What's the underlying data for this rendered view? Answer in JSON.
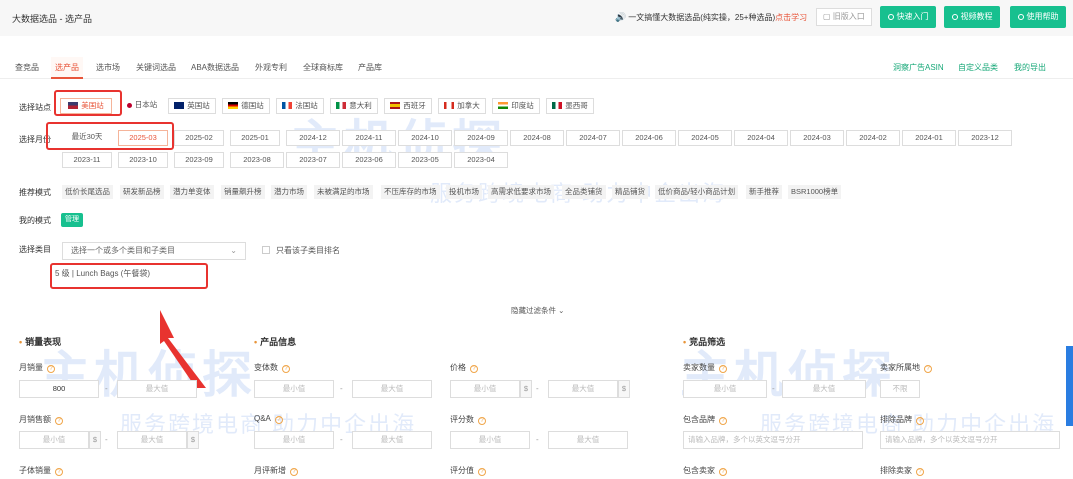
{
  "header": {
    "breadcrumb": "大数据选品 - 选产品",
    "notice": "一文搞懂大数据选品(纯实操，25+种选品)",
    "notice_link": "点击学习",
    "old_entry": "旧版入口",
    "buttons": [
      "快速入门",
      "视频教程",
      "使用帮助"
    ]
  },
  "tabs": [
    "查竞品",
    "选产品",
    "选市场",
    "关键词选品",
    "ABA数据选品",
    "外观专利",
    "全球商标库",
    "产品库"
  ],
  "active_tab": "选产品",
  "tabs_right": [
    "洞察广告ASIN",
    "自定义品类",
    "我的导出"
  ],
  "site_row": {
    "label": "选择站点",
    "sites": [
      "美国站",
      "日本站",
      "英国站",
      "德国站",
      "法国站",
      "意大利",
      "西班牙",
      "加拿大",
      "印度站",
      "墨西哥"
    ],
    "selected": "美国站"
  },
  "month_row": {
    "label": "选择月份",
    "months_row1": [
      "最近30天",
      "2025-03",
      "2025-02",
      "2025-01",
      "2024-12",
      "2024-11",
      "2024-10",
      "2024-09",
      "2024-08",
      "2024-07",
      "2024-06",
      "2024-05",
      "2024-04",
      "2024-03",
      "2024-02",
      "2024-01",
      "2023-12"
    ],
    "months_row2": [
      "2023-11",
      "2023-10",
      "2023-09",
      "2023-08",
      "2023-07",
      "2023-06",
      "2023-05",
      "2023-04"
    ],
    "selected": "2025-03"
  },
  "mode_row": {
    "label": "推荐模式",
    "modes": [
      "低价长尾选品",
      "研发新品榜",
      "潜力单变体",
      "销量飙升榜",
      "潜力市场",
      "未被满足的市场",
      "不压库存的市场",
      "投机市场",
      "高需求低要求市场",
      "全品类铺货",
      "精品铺货",
      "低价商品/轻小商品计划",
      "新手推荐",
      "BSR1000榜单"
    ]
  },
  "my_mode": {
    "label": "我的模式",
    "manage": "管理"
  },
  "category": {
    "label": "选择类目",
    "placeholder": "选择一个或多个类目和子类目",
    "checkbox_label": "只看该子类目排名",
    "selected_tag": "5 级 | Lunch Bags (午餐袋)"
  },
  "filter_toggle": "隐藏过滤条件",
  "sections": {
    "sales": {
      "title": "销量表现",
      "monthly_sales": "月销量",
      "monthly_sales_min": "800",
      "monthly_sales_max_ph": "最大值",
      "monthly_revenue": "月销售额",
      "min_ph": "最小值",
      "max_ph": "最大值",
      "currency": "$",
      "child_sales": "子体销量"
    },
    "product": {
      "title": "产品信息",
      "variants": "变体数",
      "qa": "Q&A",
      "monthly_new_reviews": "月评新增",
      "price": "价格",
      "review_count": "评分数",
      "rating": "评分值",
      "min_ph": "最小值",
      "max_ph": "最大值"
    },
    "competitors": {
      "title": "竞品筛选",
      "seller_count": "卖家数量",
      "seller_location": "卖家所属地",
      "location_ph": "不限",
      "include_brand": "包含品牌",
      "include_brand_ph": "请输入品牌，多个以英文逗号分开",
      "exclude_brand": "排除品牌",
      "exclude_brand_ph": "请输入品牌，多个以英文逗号分开",
      "include_seller": "包含卖家",
      "exclude_seller": "排除卖家",
      "min_ph": "最小值",
      "max_ph": "最大值"
    }
  },
  "watermark": {
    "title": "主机侦探",
    "subtitle": "服务跨境电商 助力中企出海"
  },
  "colors": {
    "accent": "#e8553a",
    "green": "#17c08f",
    "highlight_red": "#e8332f"
  }
}
